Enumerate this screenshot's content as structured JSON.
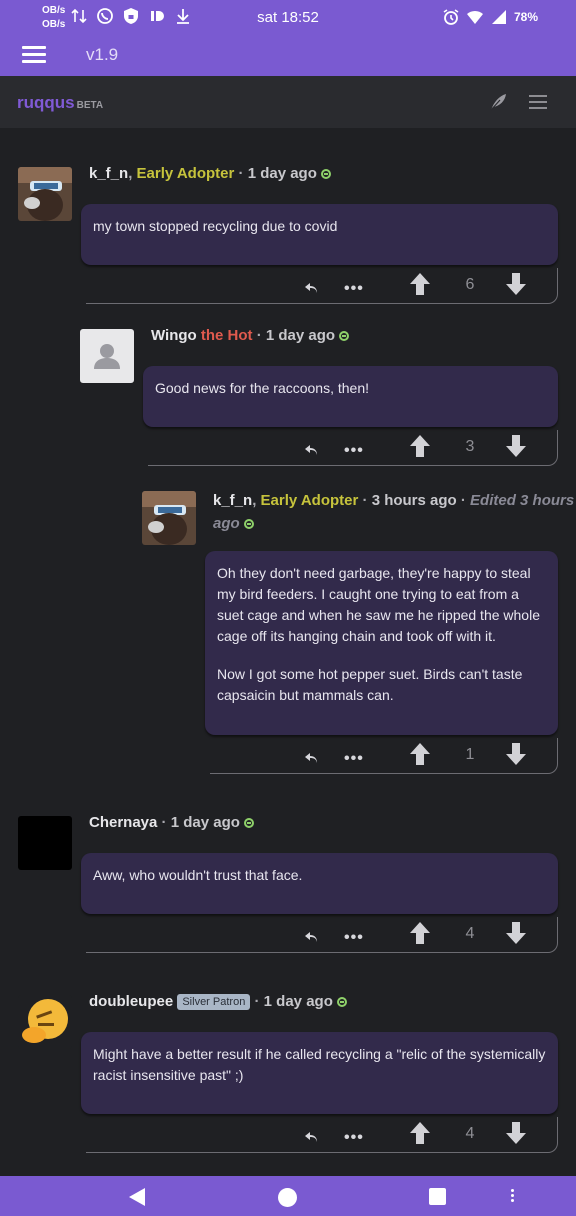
{
  "status_bar": {
    "speed_up": "OB/s",
    "speed_down": "OB/s",
    "time": "sat 18:52",
    "battery": "78%"
  },
  "app_bar": {
    "version": "v1.9"
  },
  "site": {
    "name": "ruqqus",
    "beta": "BETA"
  },
  "comments": [
    {
      "author": "k_f_n",
      "flair": "Early Adopter",
      "time": "1 day ago",
      "edited": "",
      "paragraphs": [
        "my town stopped recycling due to covid"
      ],
      "score": "6"
    },
    {
      "author": "Wingo",
      "flair": "the Hot",
      "time": "1 day ago",
      "edited": "",
      "paragraphs": [
        "Good news for the raccoons, then!"
      ],
      "score": "3"
    },
    {
      "author": "k_f_n",
      "flair": "Early Adopter",
      "time": "3 hours ago",
      "edited_line1": "Edited 3 hours",
      "edited_line2": "ago",
      "paragraphs": [
        "Oh they don't need garbage, they're happy to steal my bird feeders. I caught one trying to eat from a suet cage and when he saw me he ripped the whole cage off its hanging chain and took off with it.",
        "Now I got some hot pepper suet. Birds can't taste capsaicin but mammals can."
      ],
      "score": "1"
    },
    {
      "author": "Chernaya",
      "time": "1 day ago",
      "paragraphs": [
        "Aww, who wouldn't trust that face."
      ],
      "score": "4"
    },
    {
      "author": "doubleupee",
      "badge": "Silver Patron",
      "time": "1 day ago",
      "paragraphs": [
        "Might have a better result if he called recycling a \"relic of the systemically racist insensitive past\" ;)"
      ],
      "score": "4"
    }
  ],
  "actions": {
    "more": "•••"
  },
  "colors": {
    "brand": "#7a5ad1",
    "background": "#1f2023",
    "bubble": "#322a4b",
    "flair_early_adopter": "#c6c33c",
    "flair_hot": "#e05a4e"
  },
  "icons": [
    "reply-icon",
    "more-icon",
    "upvote-icon",
    "downvote-icon",
    "online-indicator-icon",
    "feather-icon",
    "menu-icon"
  ]
}
